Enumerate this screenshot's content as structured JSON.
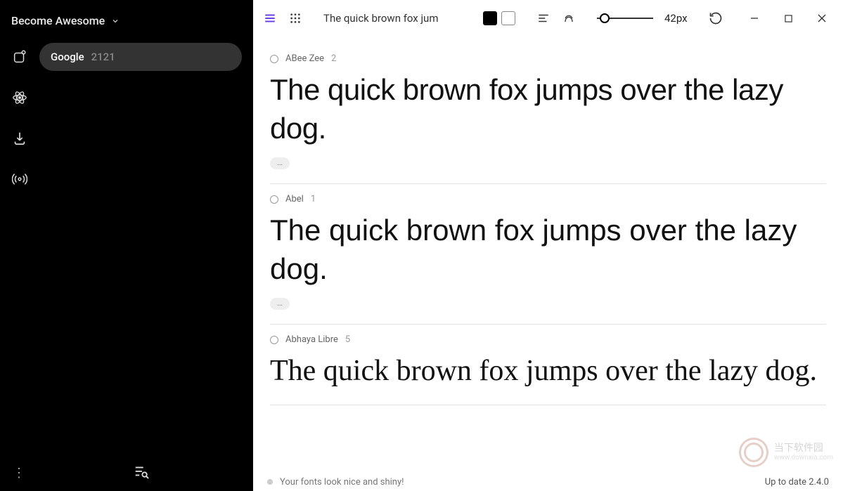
{
  "sidebar": {
    "title": "Become Awesome",
    "items": [
      {
        "label": "Google",
        "count": "2121"
      }
    ]
  },
  "toolbar": {
    "sample_text": "The quick brown fox jumps over the lazy dog.",
    "placeholder": "The quick brown fox jum",
    "size_label": "42px"
  },
  "fonts": [
    {
      "name": "ABee Zee",
      "variants": "2",
      "sample": "The quick brown fox jumps over the lazy dog."
    },
    {
      "name": "Abel",
      "variants": "1",
      "sample": "The quick brown fox jumps over the lazy dog."
    },
    {
      "name": "Abhaya Libre",
      "variants": "5",
      "sample": "The quick brown fox jumps over the lazy dog."
    }
  ],
  "status": {
    "message": "Your fonts look nice and shiny!",
    "version": "Up to date 2.4.0"
  },
  "watermark": {
    "line1": "当下软件园",
    "line2": "www.downxia.com"
  }
}
